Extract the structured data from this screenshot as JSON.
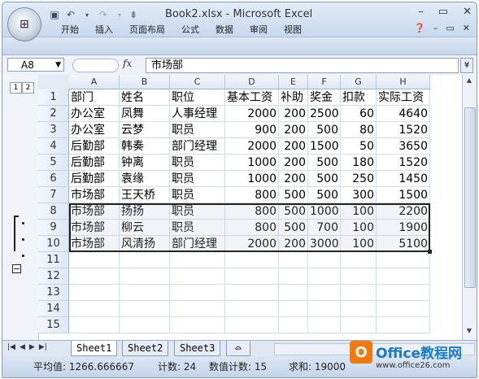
{
  "window": {
    "title": "Book2.xlsx - Microsoft Excel",
    "office_button": "Office",
    "qat": [
      "save",
      "undo",
      "redo",
      "customize"
    ],
    "controls": [
      "minimize",
      "restore",
      "close"
    ]
  },
  "ribbon": {
    "tabs": [
      "开始",
      "插入",
      "页面布局",
      "公式",
      "数据",
      "审阅",
      "视图"
    ]
  },
  "formula_bar": {
    "name_box": "A8",
    "fx": "fx",
    "content": "市场部"
  },
  "grid": {
    "outline_levels": [
      "1",
      "2"
    ],
    "columns": [
      "A",
      "B",
      "C",
      "D",
      "E",
      "F",
      "G",
      "H"
    ],
    "rows": [
      {
        "n": "1",
        "cells": [
          "部门",
          "姓名",
          "职位",
          "基本工资",
          "补助",
          "奖金",
          "扣款",
          "实际工资"
        ]
      },
      {
        "n": "2",
        "cells": [
          "办公室",
          "凤舞",
          "人事经理",
          "2000",
          "200",
          "2500",
          "60",
          "4640"
        ]
      },
      {
        "n": "3",
        "cells": [
          "办公室",
          "云梦",
          "职员",
          "900",
          "200",
          "500",
          "80",
          "1520"
        ]
      },
      {
        "n": "4",
        "cells": [
          "后勤部",
          "韩奏",
          "部门经理",
          "2000",
          "200",
          "1500",
          "50",
          "3650"
        ]
      },
      {
        "n": "5",
        "cells": [
          "后勤部",
          "钟离",
          "职员",
          "1000",
          "200",
          "500",
          "180",
          "1520"
        ]
      },
      {
        "n": "6",
        "cells": [
          "后勤部",
          "袁缘",
          "职员",
          "1000",
          "200",
          "500",
          "250",
          "1450"
        ]
      },
      {
        "n": "7",
        "cells": [
          "市场部",
          "王天桥",
          "职员",
          "800",
          "500",
          "500",
          "300",
          "1500"
        ]
      },
      {
        "n": "8",
        "cells": [
          "市场部",
          "扬扬",
          "职员",
          "800",
          "500",
          "1000",
          "100",
          "2200"
        ]
      },
      {
        "n": "9",
        "cells": [
          "市场部",
          "柳云",
          "职员",
          "800",
          "500",
          "700",
          "100",
          "1900"
        ]
      },
      {
        "n": "10",
        "cells": [
          "市场部",
          "风清扬",
          "部门经理",
          "2000",
          "200",
          "3000",
          "100",
          "5100"
        ]
      },
      {
        "n": "11",
        "cells": [
          "",
          "",
          "",
          "",
          "",
          "",
          "",
          ""
        ]
      },
      {
        "n": "12",
        "cells": [
          "",
          "",
          "",
          "",
          "",
          "",
          "",
          ""
        ]
      },
      {
        "n": "13",
        "cells": [
          "",
          "",
          "",
          "",
          "",
          "",
          "",
          ""
        ]
      },
      {
        "n": "14",
        "cells": [
          "",
          "",
          "",
          "",
          "",
          "",
          "",
          ""
        ]
      },
      {
        "n": "15",
        "cells": [
          "",
          "",
          "",
          "",
          "",
          "",
          "",
          ""
        ]
      }
    ],
    "outline_button": "−"
  },
  "sheet_tabs": [
    "Sheet1",
    "Sheet2",
    "Sheet3"
  ],
  "status_bar": {
    "average": "平均值: 1266.666667",
    "count": "计数: 24",
    "numeric_count": "数值计数: 15",
    "sum": "求和: 19000"
  },
  "watermark": {
    "name": "Office教程网",
    "url": "www.office26.com"
  }
}
